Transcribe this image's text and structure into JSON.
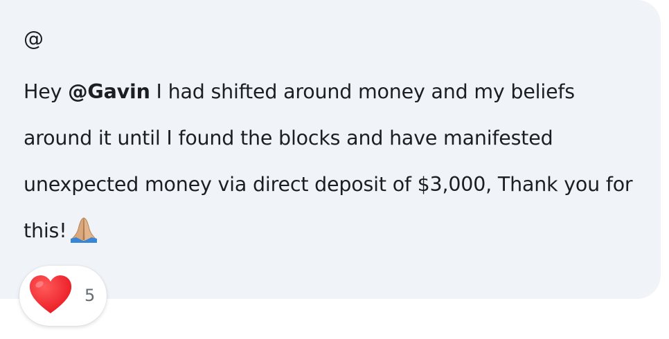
{
  "comment": {
    "author_mention": "@",
    "message": {
      "greeting": "Hey ",
      "mention": "@Gavin",
      "body": " I had shifted around money and my beliefs around it until I found the blocks and have manifested unexpected money via direct deposit of $3,000, Thank you for this!",
      "emoji": "folded-hands-emoji"
    },
    "bubble_color": "#f0f4f8"
  },
  "reaction": {
    "icon": "heart-icon",
    "count": "5",
    "color": "#e8141e"
  }
}
